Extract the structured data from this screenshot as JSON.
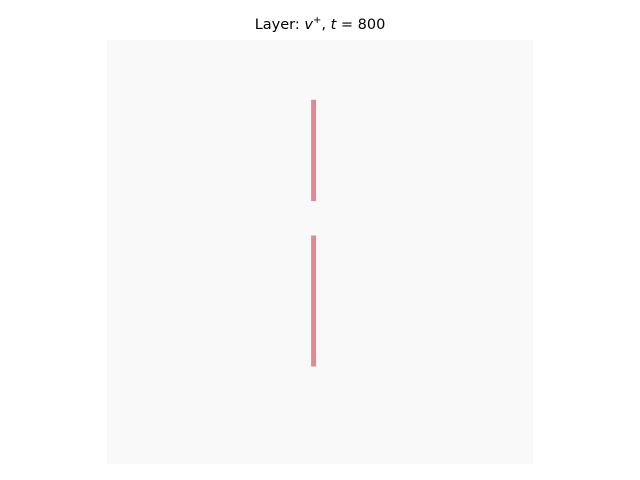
{
  "title": {
    "prefix": "Layer: ",
    "var": "v",
    "sup": "+",
    "sep": ", ",
    "t_var": "t",
    "eq": " = ",
    "t_value": "800"
  },
  "chart_data": {
    "type": "heatmap",
    "title": "Layer: v+, t = 800",
    "xlabel": "",
    "ylabel": "",
    "grid": false,
    "axes_visible": false,
    "xlim": [
      0,
      100
    ],
    "ylim": [
      0,
      100
    ],
    "background_color": "#f9f9f9",
    "segment_color": "#d68c99",
    "segments": [
      {
        "name": "upper-segment",
        "x": 48.5,
        "y_start": 14.1,
        "y_end": 38.0
      },
      {
        "name": "lower-segment",
        "x": 48.5,
        "y_start": 46.1,
        "y_end": 77.0
      }
    ]
  }
}
